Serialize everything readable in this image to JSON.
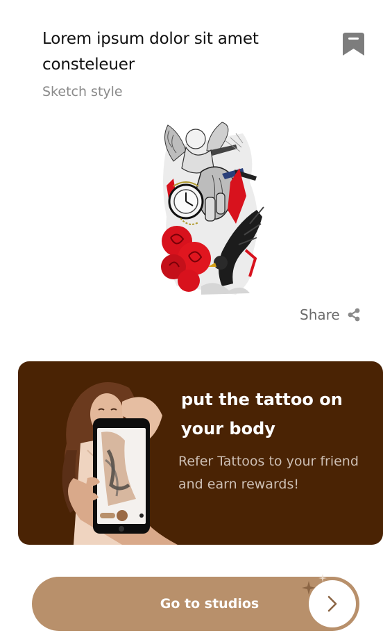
{
  "header": {
    "title": "Lorem ipsum dolor sit amet consteleuer",
    "subtitle": "Sketch style",
    "bookmark_icon": "bookmark-icon"
  },
  "design": {
    "image": "tattoo-sleeve-illustration"
  },
  "share": {
    "label": "Share",
    "icon": "share-icon"
  },
  "promo": {
    "title": "put the tattoo on your body",
    "text": "Refer Tattoos to your friend and earn rewards!",
    "image": "woman-with-phone-illustration"
  },
  "cta": {
    "label": "Go to studios",
    "icon": "chevron-right-icon"
  },
  "colors": {
    "promo_bg": "#4a2304",
    "cta_bg": "#b8906b",
    "bookmark": "#7d7d7d",
    "share_text": "#6b6b6b",
    "accent_red": "#d8121d"
  }
}
